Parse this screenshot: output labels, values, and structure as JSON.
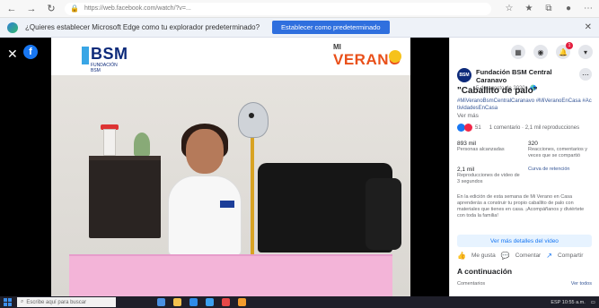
{
  "browser": {
    "url": "https://web.facebook.com/watch/?v=...",
    "icons": {
      "back": "back-arrow-icon",
      "forward": "forward-arrow-icon",
      "refresh": "refresh-icon",
      "lock": "lock-icon"
    }
  },
  "notification": {
    "text": "¿Quieres establecer Microsoft Edge como tu explorador predeterminado?",
    "button_label": "Establecer como predeterminado",
    "close_icon": "close-icon"
  },
  "video": {
    "overlay_brand": "BSM",
    "overlay_brand_sub": "FUNDACIÓN BSM",
    "overlay_campaign_mi": "MI",
    "overlay_campaign": "VERANO"
  },
  "side_panel": {
    "page_name": "Fundación BSM Central Caranavo",
    "post_date": "5 de agosto de 2020 · 🌎",
    "title": "\"Caballito de palo\"",
    "hashtags": "#MiVeranoBsmCentralCaranavo #MiVeranoEnCasa #ActividadesEnCasa",
    "see_more": "Ver más",
    "reaction_count": "51",
    "comments_shares": "1 comentario · 2,1 mil reproducciones",
    "stats": [
      {
        "value": "893 mil",
        "label": "Personas alcanzadas"
      },
      {
        "value": "320",
        "label": "Reacciones, comentarios y veces que se compartió"
      },
      {
        "value": "2,1 mil",
        "label": "Reproducciones de video de 3 segundos"
      },
      {
        "value": "",
        "label": "Curva de retención"
      }
    ],
    "description": "En la edición de esta semana de Mi Verano en Casa aprenderás a construir tu propio caballito de palo con materiales que tienes en casa. ¡Acompáñanos y diviértete con toda la familia!",
    "watch_button": "Ver más detalles del video",
    "actions": {
      "like": "Me gusta",
      "comment": "Comentar",
      "share": "Compartir"
    },
    "next_title": "A continuación",
    "comment_label": "Comentarios",
    "comment_link": "Ver todos"
  },
  "taskbar": {
    "search_placeholder": "Escribe aquí para buscar",
    "tray_text": "ESP 10:55 a.m."
  }
}
